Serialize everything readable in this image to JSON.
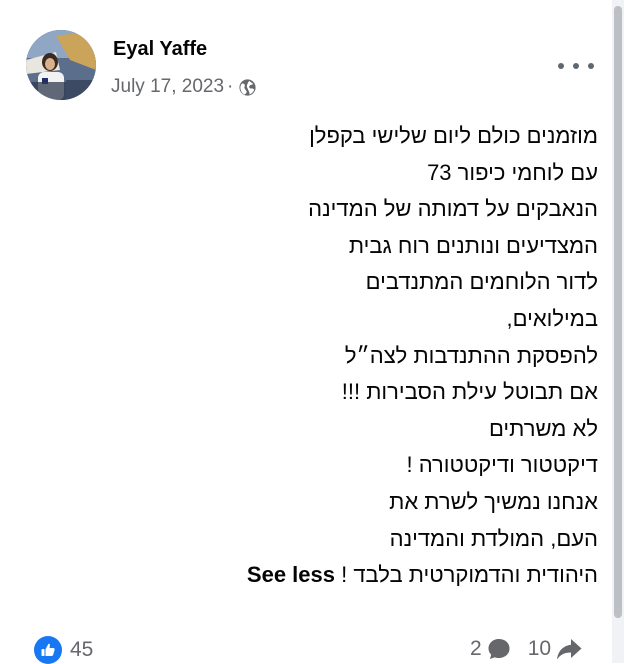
{
  "post": {
    "author": "Eyal Yaffe",
    "date": "July 17, 2023",
    "separator": "·",
    "audience_icon": "globe-icon",
    "more_icon": "more-options-icon",
    "lines": [
      "מוזמנים כולם ליום שלישי בקפלן",
      "עם לוחמי כיפור 73",
      "הנאבקים על דמותה של המדינה",
      "המצדיעים ונותנים רוח גבית",
      "לדור הלוחמים המתנדבים",
      "במילואים,",
      "להפסקת ההתנדבות לצה״ל",
      "אם תבוטל עילת הסבירות !!!",
      "לא משרתים",
      "דיקטטור ודיקטטורה !",
      "אנחנו נמשיך לשרת את",
      "העם, המולדת והמדינה"
    ],
    "last_line": "היהודית והדמוקרטית בלבד !",
    "see_less": "See less"
  },
  "footer": {
    "reaction_icon": "like-icon",
    "reactions_count": "45",
    "comments_count": "2",
    "comment_icon": "comment-icon",
    "shares_count": "10",
    "share_icon": "share-icon"
  },
  "colors": {
    "accent": "#1877f2",
    "text": "#050505",
    "secondary_text": "#65676b"
  }
}
